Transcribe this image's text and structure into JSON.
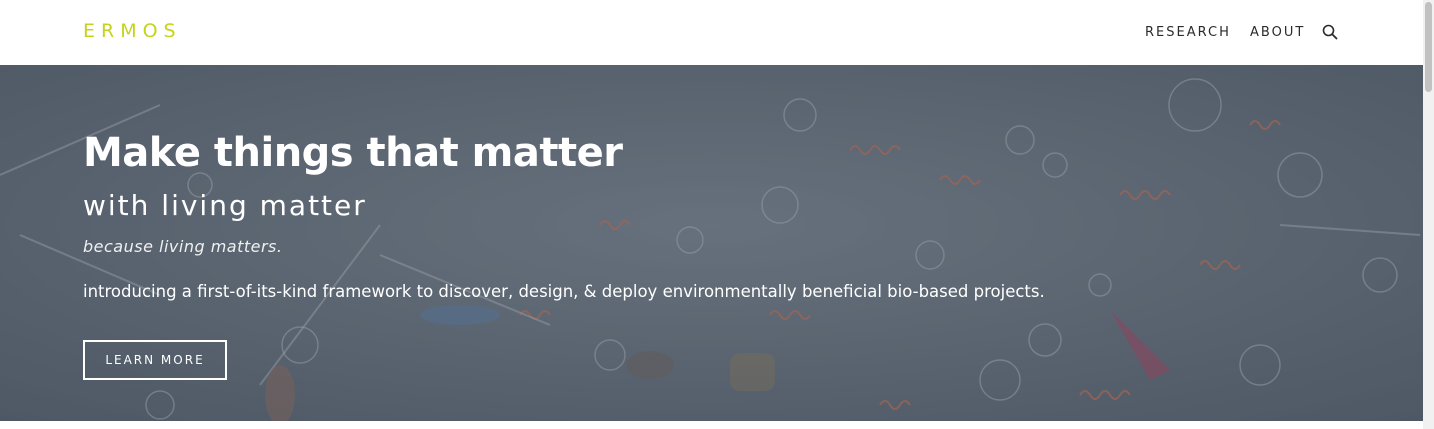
{
  "nav": {
    "logo": "ERMOS",
    "links": [
      {
        "label": "RESEARCH"
      },
      {
        "label": "ABOUT"
      }
    ],
    "search_icon": "search-icon"
  },
  "hero": {
    "headline": "Make things that matter",
    "subhead": "with living matter",
    "tagline": "because living matters.",
    "intro": "introducing a first-of-its-kind framework to discover, design, & deploy environmentally beneficial bio-based projects.",
    "cta_label": "LEARN MORE",
    "background_image": "microscope view of plankton and microorganisms"
  },
  "colors": {
    "logo": "#c5d41a",
    "nav_text": "#2b2b2b",
    "hero_text": "#ffffff"
  }
}
